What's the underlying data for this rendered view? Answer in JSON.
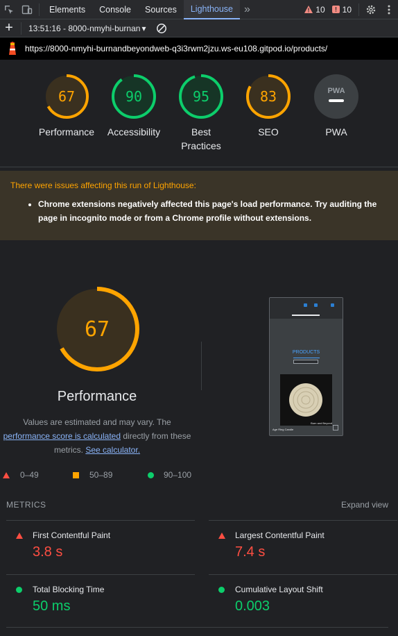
{
  "devtools": {
    "tabs": [
      "Elements",
      "Console",
      "Sources",
      "Lighthouse"
    ],
    "active_tab": "Lighthouse",
    "more": "»",
    "warnings_count": "10",
    "errors_count": "10"
  },
  "report_bar": {
    "add": "+",
    "report_label": "13:51:16 - 8000-nmyhi-burnan",
    "dropdown_arrow": "▾",
    "clear_icon": "clear-icon"
  },
  "url": "https://8000-nmyhi-burnandbeyondweb-q3i3rwm2jzu.ws-eu108.gitpod.io/products/",
  "gauges": [
    {
      "score": "67",
      "label": "Performance",
      "value": 67,
      "color": "#ffa400"
    },
    {
      "score": "90",
      "label": "Accessibility",
      "value": 90,
      "color": "#0cce6b"
    },
    {
      "score": "95",
      "label": "Best Practices",
      "value": 95,
      "color": "#0cce6b"
    },
    {
      "score": "83",
      "label": "SEO",
      "value": 83,
      "color": "#ffa400"
    },
    {
      "score": "PWA",
      "label": "PWA"
    }
  ],
  "warning": {
    "title": "There were issues affecting this run of Lighthouse:",
    "item": "Chrome extensions negatively affected this page's load performance. Try auditing the page in incognito mode or from a Chrome profile without extensions."
  },
  "performance": {
    "score": "67",
    "value": 67,
    "title": "Performance",
    "note_a": "Values are estimated and may vary. The",
    "note_link": "performance score is calculated",
    "note_b": "directly from these metrics.",
    "note_link2": "See calculator."
  },
  "screenshot": {
    "heading": "PRODUCTS",
    "caption": "Burn and Beyond",
    "footer": "Age Ring Candle"
  },
  "legend": [
    {
      "range": "0–49",
      "color": "#ff4e42"
    },
    {
      "range": "50–89",
      "color": "#ffa400"
    },
    {
      "range": "90–100",
      "color": "#0cce6b"
    }
  ],
  "metrics": {
    "heading": "METRICS",
    "expand": "Expand view",
    "items": [
      {
        "name": "First Contentful Paint",
        "value": "3.8 s",
        "status": "red"
      },
      {
        "name": "Largest Contentful Paint",
        "value": "7.4 s",
        "status": "red"
      },
      {
        "name": "Total Blocking Time",
        "value": "50 ms",
        "status": "green"
      },
      {
        "name": "Cumulative Layout Shift",
        "value": "0.003",
        "status": "green"
      }
    ]
  },
  "colors": {
    "orange": "#ffa400",
    "green": "#0cce6b",
    "red": "#ff4e42",
    "link": "#8ab4f8"
  }
}
